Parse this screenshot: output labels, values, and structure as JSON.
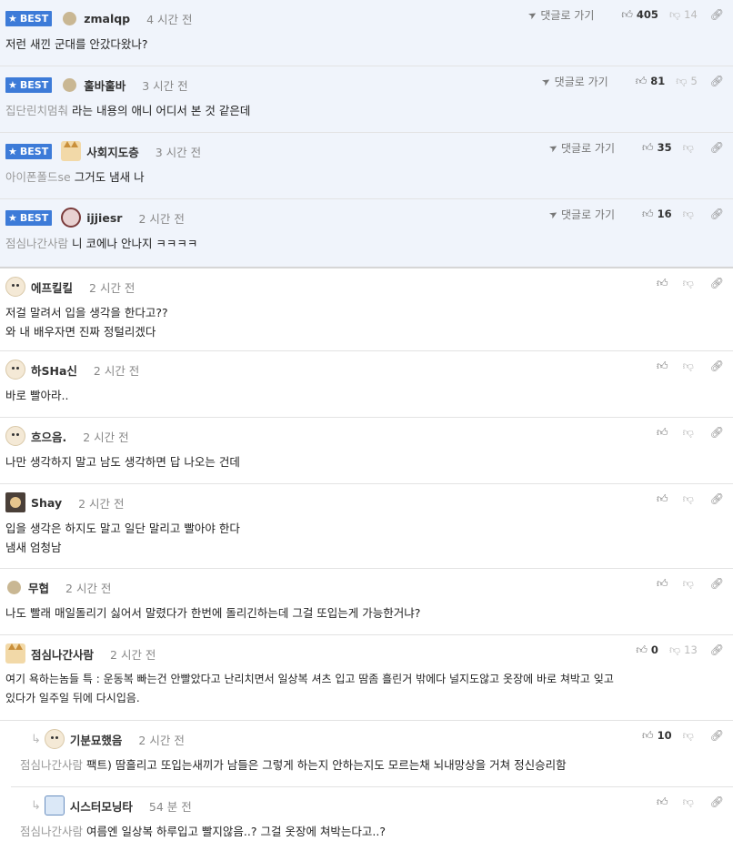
{
  "best_label": "BEST",
  "goto_label": "댓글로 가기",
  "comments": [
    {
      "nick": "zmalqp",
      "time": "4 시간 전",
      "up": "405",
      "down": "14",
      "mention": "",
      "text": [
        "저런 새낀 군대를 안갔다왔나?"
      ]
    },
    {
      "nick": "훌바훌바",
      "time": "3 시간 전",
      "up": "81",
      "down": "5",
      "mention": "집단린치멈춰",
      "text": [
        "라는 내용의 애니 어디서 본 것 같은데"
      ]
    },
    {
      "nick": "사회지도층",
      "time": "3 시간 전",
      "up": "35",
      "down": "",
      "mention": "아이폰폴드se",
      "text": [
        "그거도 냄새 나"
      ]
    },
    {
      "nick": "ijjiesr",
      "time": "2 시간 전",
      "up": "16",
      "down": "",
      "mention": "점심나간사람",
      "text": [
        "니 코에나 안나지 ㅋㅋㅋㅋ"
      ]
    },
    {
      "nick": "에프킬킬",
      "time": "2 시간 전",
      "up": "",
      "down": "",
      "mention": "",
      "text": [
        "저걸 말려서 입을 생각을 한다고??",
        "와 내 배우자면 진짜 정털리겠다"
      ]
    },
    {
      "nick": "하SHa신",
      "time": "2 시간 전",
      "up": "",
      "down": "",
      "mention": "",
      "text": [
        "바로 빨아라.."
      ]
    },
    {
      "nick": "흐으음.",
      "time": "2 시간 전",
      "up": "",
      "down": "",
      "mention": "",
      "text": [
        "나만 생각하지 말고 남도 생각하면 답 나오는 건데"
      ]
    },
    {
      "nick": "Shay",
      "time": "2 시간 전",
      "up": "",
      "down": "",
      "mention": "",
      "text": [
        "입을 생각은 하지도 말고 일단 말리고 빨아야 한다",
        "냄새 엄청남"
      ]
    },
    {
      "nick": "무협",
      "time": "2 시간 전",
      "up": "",
      "down": "",
      "mention": "",
      "text": [
        "나도 빨래 매일돌리기 싫어서 말렸다가 한번에 돌리긴하는데 그걸 또입는게 가능한거냐?"
      ]
    },
    {
      "nick": "점심나간사람",
      "time": "2 시간 전",
      "up": "0",
      "down": "13",
      "mention": "",
      "text": [
        "여기 욕하는놈들 특 : 운동복 빠는건 안빨았다고 난리치면서 일상복 셔츠 입고 땀좀 흘린거 밖에다 널지도않고 옷장에 바로 쳐박고 잊고",
        "있다가 일주일 뒤에 다시입음."
      ]
    },
    {
      "nick": "기분묘했음",
      "time": "2 시간 전",
      "up": "10",
      "down": "",
      "mention": "점심나간사람",
      "text": [
        "팩트) 땀흘리고 또입는새끼가 남들은 그렇게 하는지 안하는지도 모르는채 뇌내망상을 거쳐 정신승리함"
      ]
    },
    {
      "nick": "시스터모닝타",
      "time": "54 분 전",
      "up": "",
      "down": "",
      "mention": "점심나간사람",
      "text": [
        "여름엔 일상복 하루입고 빨지않음..? 그걸 옷장에 쳐박는다고..?"
      ]
    }
  ],
  "icons": {
    "thumb_up": "thumbs-up-icon",
    "thumb_down": "thumbs-down-icon",
    "link": "link-icon",
    "goto": "paper-plane-icon",
    "star": "star-icon",
    "reply": "reply-arrow-icon"
  }
}
